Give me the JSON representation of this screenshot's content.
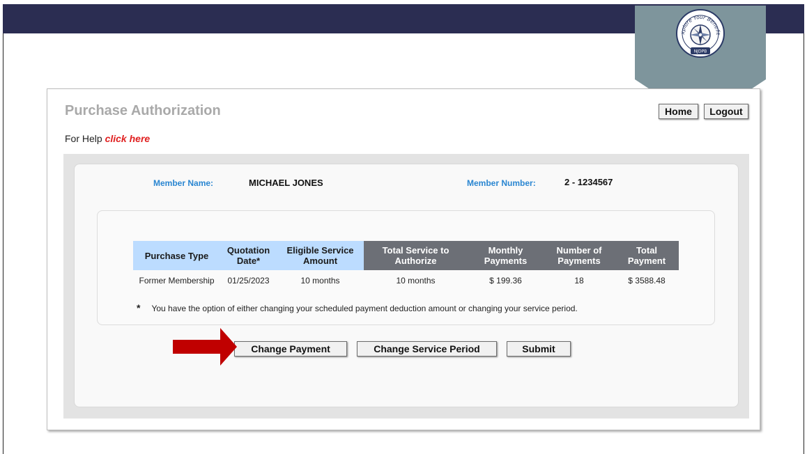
{
  "header": {
    "logo_text": "Explore Your Benefits",
    "logo_subtext": "NJDPB"
  },
  "page": {
    "title": "Purchase Authorization",
    "help_prefix": "For Help ",
    "help_link": "click here"
  },
  "nav": {
    "home_label": "Home",
    "logout_label": "Logout"
  },
  "member": {
    "name_label": "Member Name:",
    "name_value": "MICHAEL JONES",
    "number_label": "Member Number:",
    "number_value": "2 - 1234567"
  },
  "table": {
    "columns": [
      {
        "label": "Purchase Type"
      },
      {
        "label": "Quotation Date*"
      },
      {
        "label": "Eligible Service Amount"
      },
      {
        "label": "Total Service to Authorize"
      },
      {
        "label": "Monthly Payments"
      },
      {
        "label": "Number of Payments"
      },
      {
        "label": "Total Payment"
      }
    ],
    "rows": [
      [
        "Former Membership",
        "01/25/2023",
        "10 months",
        "10 months",
        "$ 199.36",
        "18",
        "$ 3588.48"
      ]
    ]
  },
  "note": {
    "symbol": "*",
    "text": "You have the option of either changing your scheduled payment deduction amount or changing your service period."
  },
  "actions": {
    "change_payment_label": "Change Payment",
    "change_service_label": "Change Service Period",
    "submit_label": "Submit"
  },
  "colors": {
    "topbar": "#2b2d52",
    "header_light": "#bcdcff",
    "header_dark": "#6c6f76",
    "label_blue": "#2a86d1",
    "link_red": "#e02020",
    "arrow_red": "#c00000",
    "shield": "#7e959c"
  }
}
